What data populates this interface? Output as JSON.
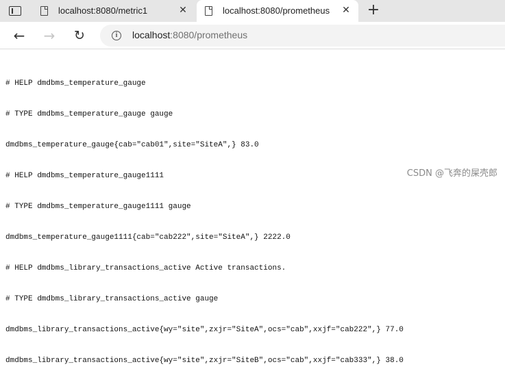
{
  "tabs": [
    {
      "title": "localhost:8080/metric1",
      "close_glyph": "✕",
      "icon": "page-icon"
    },
    {
      "title": "localhost:8080/prometheus",
      "close_glyph": "✕",
      "icon": "page-icon"
    }
  ],
  "new_tab_glyph": "+",
  "toolbar": {
    "back_glyph": "←",
    "forward_glyph": "→",
    "reload_glyph": "↻",
    "info_glyph": "i",
    "url_host": "localhost",
    "url_path": ":8080/prometheus"
  },
  "content": {
    "lines": [
      "# HELP dmdbms_temperature_gauge",
      "# TYPE dmdbms_temperature_gauge gauge",
      "dmdbms_temperature_gauge{cab=\"cab01\",site=\"SiteA\",} 83.0",
      "# HELP dmdbms_temperature_gauge1111",
      "# TYPE dmdbms_temperature_gauge1111 gauge",
      "dmdbms_temperature_gauge1111{cab=\"cab222\",site=\"SiteA\",} 2222.0",
      "# HELP dmdbms_library_transactions_active Active transactions.",
      "# TYPE dmdbms_library_transactions_active gauge",
      "dmdbms_library_transactions_active{wy=\"site\",zxjr=\"SiteA\",ocs=\"cab\",xxjf=\"cab222\",} 77.0",
      "dmdbms_library_transactions_active{wy=\"site\",zxjr=\"SiteB\",ocs=\"cab\",xxjf=\"cab333\",} 38.0"
    ]
  },
  "watermark": "CSDN @飞奔的屎壳郎"
}
